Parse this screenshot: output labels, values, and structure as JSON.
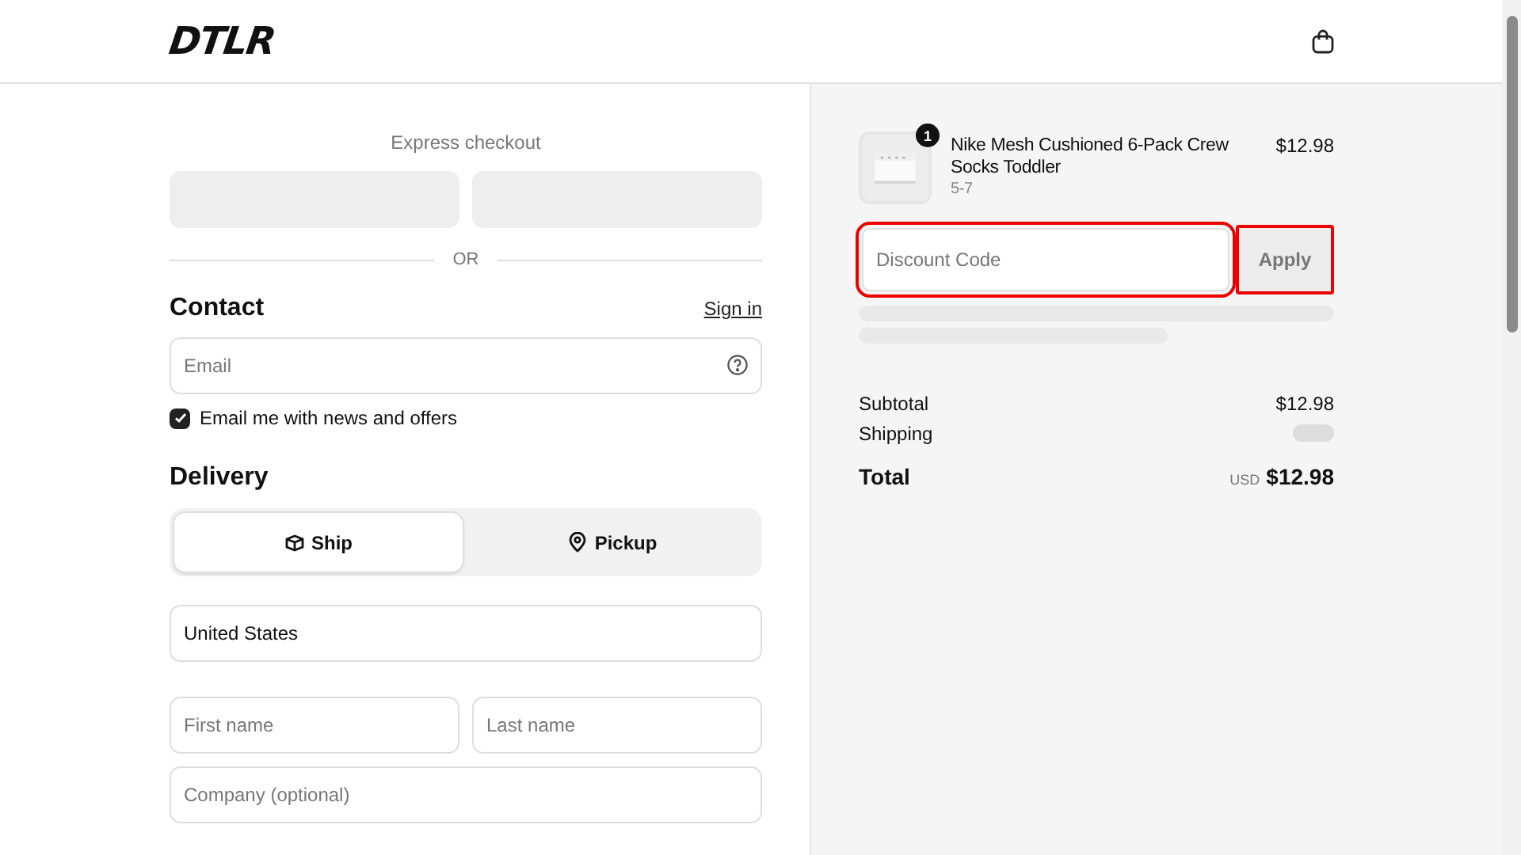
{
  "header": {
    "logo": "DTLR"
  },
  "express_checkout": {
    "label": "Express checkout",
    "divider": "OR"
  },
  "contact": {
    "heading": "Contact",
    "sign_in": "Sign in",
    "email": {
      "placeholder": "Email"
    },
    "newsletter": {
      "label": "Email me with news and offers",
      "checked": true
    }
  },
  "delivery": {
    "heading": "Delivery",
    "options": [
      {
        "label": "Ship",
        "kind": "ship",
        "selected": true
      },
      {
        "label": "Pickup",
        "kind": "pickup",
        "selected": false
      }
    ],
    "rows": [
      {
        "fields": [
          {
            "value": "United States"
          }
        ]
      },
      {
        "fields": [
          {
            "placeholder": "First name"
          },
          {
            "placeholder": "Last name"
          }
        ]
      },
      {
        "fields": [
          {
            "placeholder": "Company (optional)"
          }
        ]
      }
    ]
  },
  "order": {
    "items": [
      {
        "name": "Nike Mesh Cushioned 6-Pack Crew Socks Toddler",
        "variant": "5-7",
        "price": "$12.98",
        "quantity": "1"
      }
    ],
    "discount": {
      "placeholder": "Discount Code",
      "button": "Apply",
      "highlighted": true
    },
    "subtotal": {
      "label": "Subtotal",
      "value": "$12.98"
    },
    "shipping": {
      "label": "Shipping"
    },
    "total": {
      "label": "Total",
      "currency": "USD",
      "value": "$12.98"
    }
  }
}
